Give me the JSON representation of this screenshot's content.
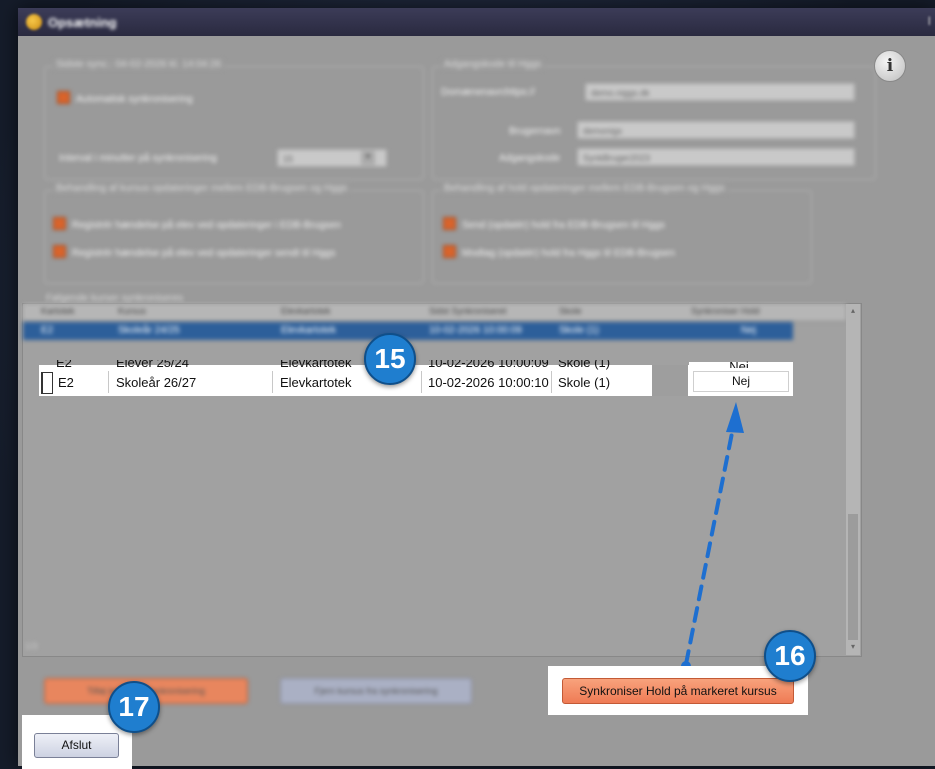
{
  "window": {
    "title": "Opsætning",
    "close_glyph": "I"
  },
  "sync_group": {
    "legend": "Sidste sync.: 04-02-2026 kl. 14:04:26",
    "auto_sync_label": "Automatisk synkronisering",
    "interval_label": "Interval i minutter på synkronisering",
    "interval_value": "15"
  },
  "access_group": {
    "legend": "Adgangskode til Hggs",
    "domain_label": "Domænenavn:",
    "domain_prefix": "https://",
    "domain_value": "demo.niggs.dk",
    "user_label": "Brugernavn",
    "user_value": "demonigs",
    "password_label": "Adgangskode",
    "password_value": "SynkBruger2023"
  },
  "course_updates_group": {
    "legend": "Behandling af kursus opdateringer mellem EDB-Brugsen og Hggs",
    "option1": "Registrér hændelse på elev ved opdateringer i EDB-Brugsen",
    "option2": "Registrér hændelse på elev ved opdateringer sendt til Hggs"
  },
  "hold_updates_group": {
    "legend": "Behandling af hold opdateringer mellem EDB-Brugsen og Hggs",
    "option1": "Send (opdatér) hold fra EDB-Brugsen til Hggs",
    "option2": "Modtag (opdatér) hold fra Hggs til EDB-Brugsen"
  },
  "grid": {
    "legend": "Følgende kurser synkroniseres",
    "columns": [
      "Kartotek",
      "Kursus",
      "Elevkartotek",
      "Sidst Synkroniseret",
      "Skole",
      "Synkroniser Hold"
    ],
    "rows": [
      {
        "kartotek": "E2",
        "kursus": "Skoleår 24/25",
        "elevkartotek": "Elevkartotek",
        "sidst": "10-02-2026 10:00:09",
        "skole": "Skole (1)",
        "hold": "Nej"
      },
      {
        "kartotek": "E2",
        "kursus": "Elever 25/24",
        "elevkartotek": "Elevkartotek",
        "sidst": "10-02-2026 10:00:09",
        "skole": "Skole (1)",
        "hold": "Nej"
      },
      {
        "kartotek": "E2",
        "kursus": "Skoleår 26/27",
        "elevkartotek": "Elevkartotek",
        "sidst": "10-02-2026 10:00:10",
        "skole": "Skole (1)",
        "hold": "Nej"
      }
    ],
    "footer": "1/3"
  },
  "buttons": {
    "add_course": "Tilføj kursus til synkronisering",
    "remove_course": "Fjern kursus fra synkronisering",
    "sync_hold": "Synkroniser Hold på markeret kursus",
    "close": "Afslut"
  },
  "annotations": {
    "badge_15": "15",
    "badge_16": "16",
    "badge_17": "17"
  },
  "icons": {
    "app": "app-icon",
    "info": "info-icon",
    "info_glyph": "i",
    "dropdown": "dropdown-arrow-icon",
    "scroll_up": "scroll-up-icon",
    "scroll_down": "scroll-down-icon",
    "arrow_glyph": "▴",
    "arrow_down_glyph": "▾"
  },
  "colors": {
    "badge_blue": "#1f7ecf",
    "checkbox_orange": "#d9642b",
    "sync_button": "#f08860",
    "selection_blue": "#2d5f9a",
    "arrow_blue": "#1e6fd0"
  }
}
